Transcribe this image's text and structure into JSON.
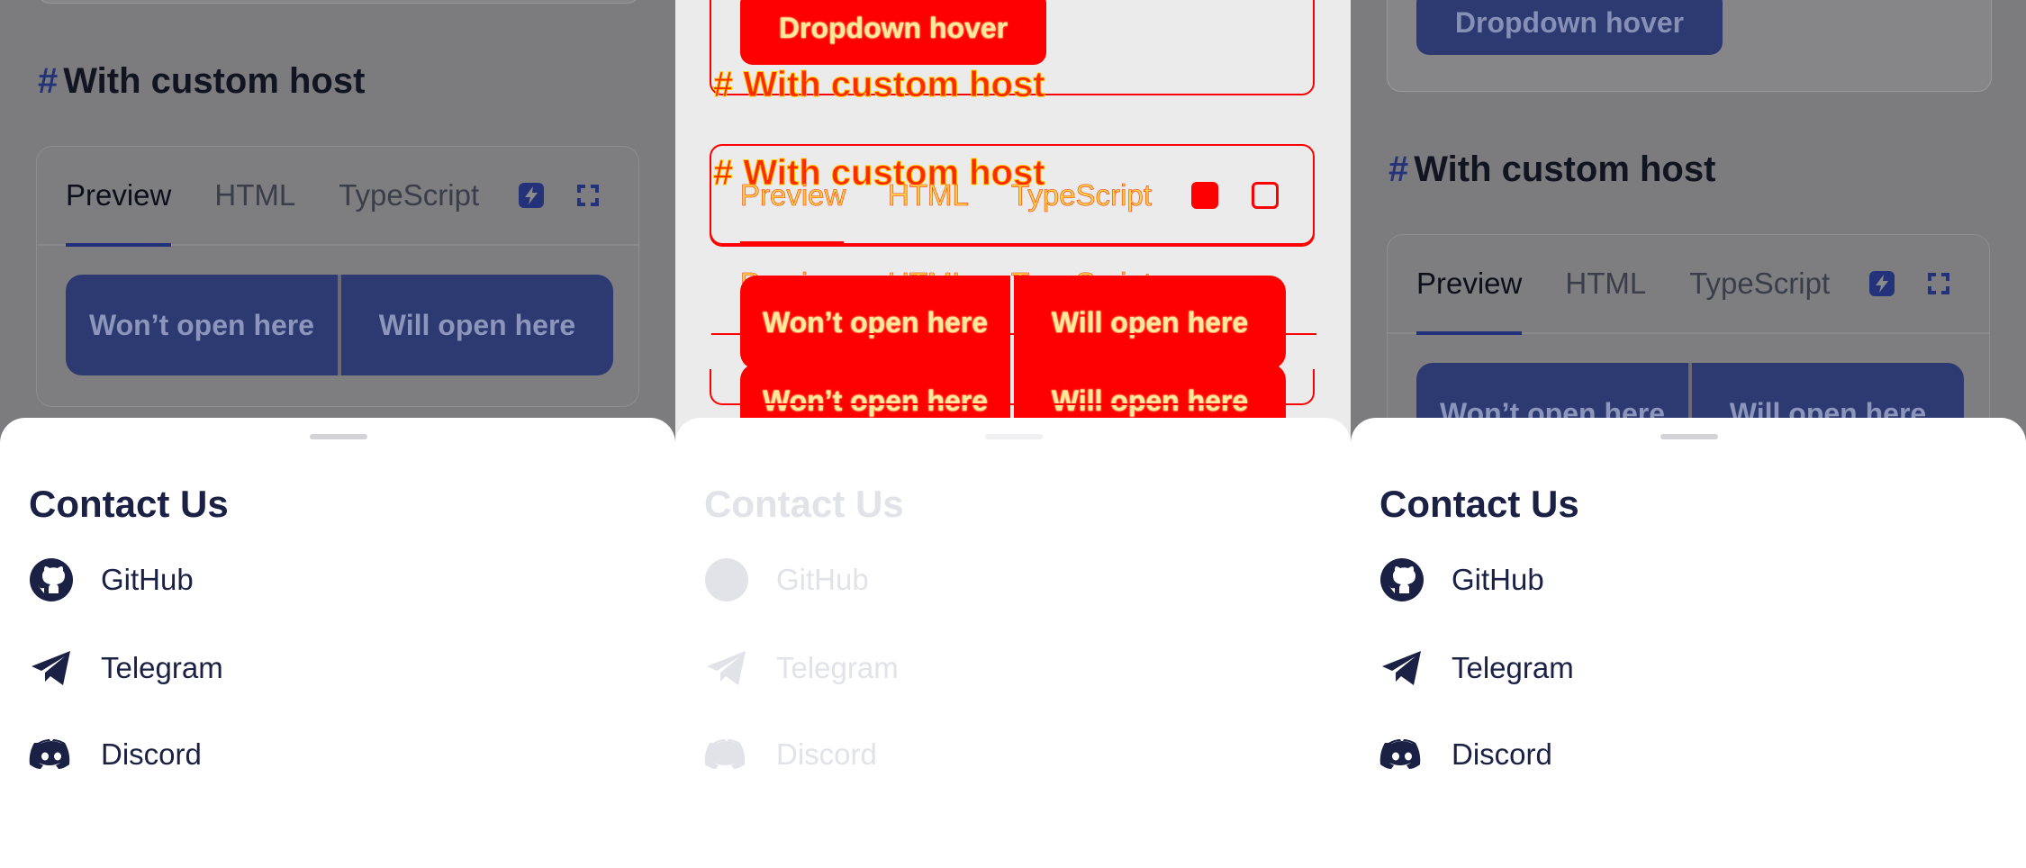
{
  "heading": {
    "hash": "#",
    "text": "With custom host"
  },
  "dropdown_button": "Dropdown hover",
  "tabs": [
    "Preview",
    "HTML",
    "TypeScript"
  ],
  "buttons": {
    "left": "Won’t open here",
    "right": "Will open here"
  },
  "sheet": {
    "title": "Contact Us",
    "items": [
      {
        "label": "GitHub",
        "icon": "github-icon"
      },
      {
        "label": "Telegram",
        "icon": "telegram-icon"
      },
      {
        "label": "Discord",
        "icon": "discord-icon"
      }
    ]
  },
  "colors": {
    "primary": "#2d3a72",
    "text_dark": "#1a2144",
    "overlay_gray": "#7c7c7e",
    "debug_red": "#ff0000",
    "debug_yellow": "#ffd24a"
  }
}
